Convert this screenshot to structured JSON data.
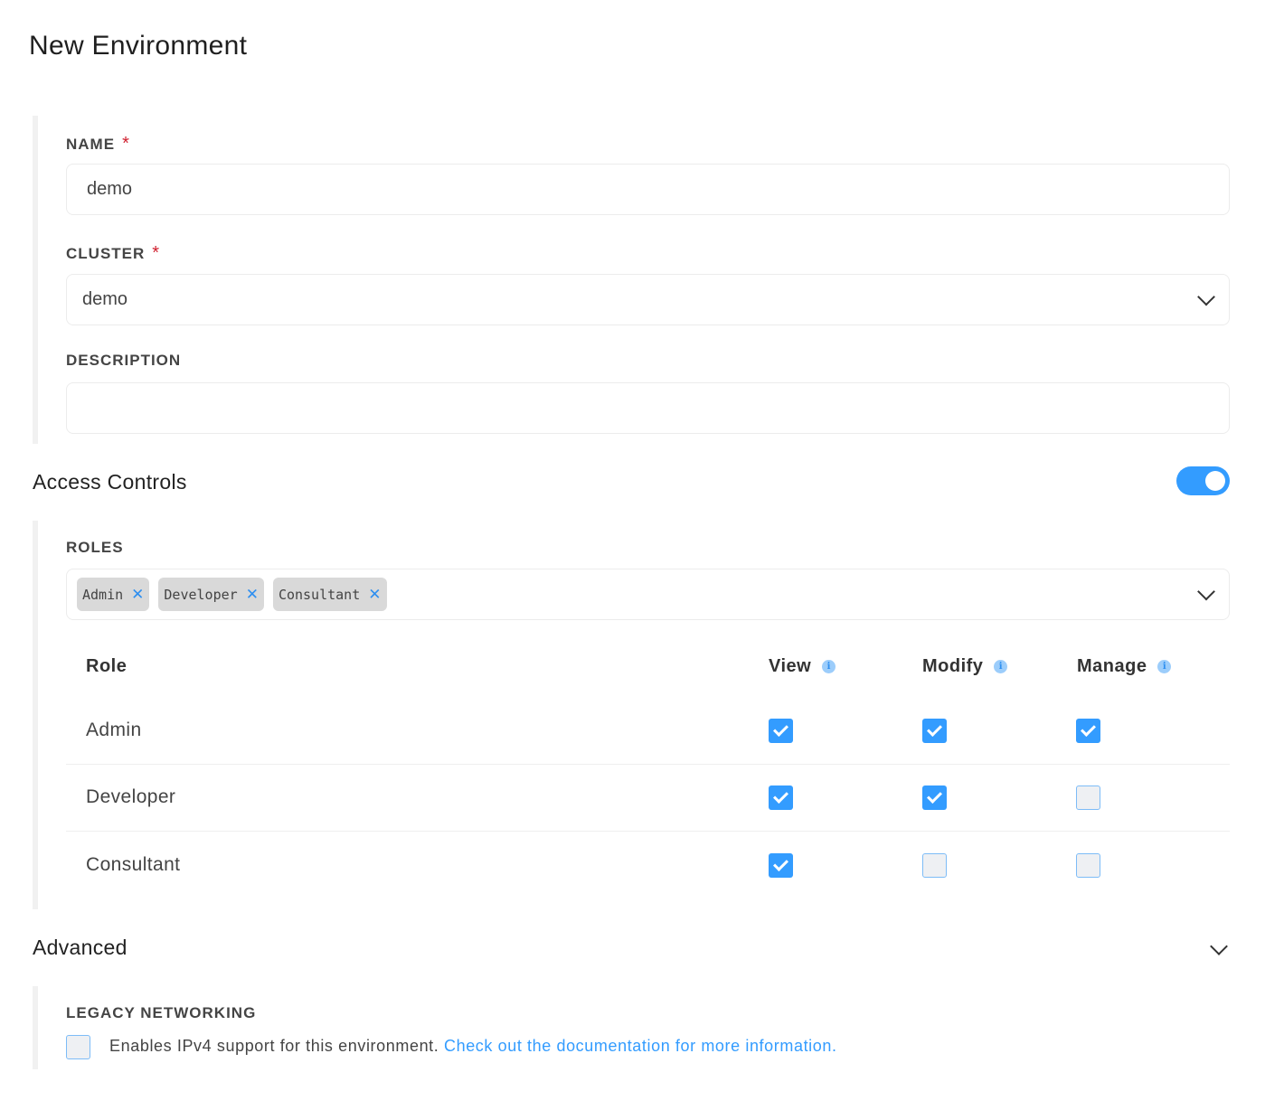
{
  "page": {
    "title": "New Environment"
  },
  "form": {
    "name": {
      "label": "NAME",
      "required_mark": "*",
      "value": "demo"
    },
    "cluster": {
      "label": "CLUSTER",
      "required_mark": "*",
      "value": "demo"
    },
    "description": {
      "label": "DESCRIPTION",
      "value": ""
    }
  },
  "access_controls": {
    "title": "Access Controls",
    "enabled": true,
    "roles_label": "ROLES",
    "selected_roles": [
      {
        "label": "Admin",
        "remove": "✕"
      },
      {
        "label": "Developer",
        "remove": "✕"
      },
      {
        "label": "Consultant",
        "remove": "✕"
      }
    ],
    "table": {
      "headers": {
        "role": "Role",
        "view": "View",
        "modify": "Modify",
        "manage": "Manage",
        "info_glyph": "i"
      },
      "rows": [
        {
          "role": "Admin",
          "view": true,
          "modify": true,
          "manage": true
        },
        {
          "role": "Developer",
          "view": true,
          "modify": true,
          "manage": false
        },
        {
          "role": "Consultant",
          "view": true,
          "modify": false,
          "manage": false
        }
      ]
    }
  },
  "advanced": {
    "title": "Advanced",
    "legacy_networking": {
      "label": "LEGACY NETWORKING",
      "checked": false,
      "description": "Enables IPv4 support for this environment. ",
      "link_text": "Check out the documentation for more information."
    }
  },
  "colors": {
    "accent": "#339cff",
    "required": "#d0202f",
    "chip_bg": "#d9d9d9"
  }
}
